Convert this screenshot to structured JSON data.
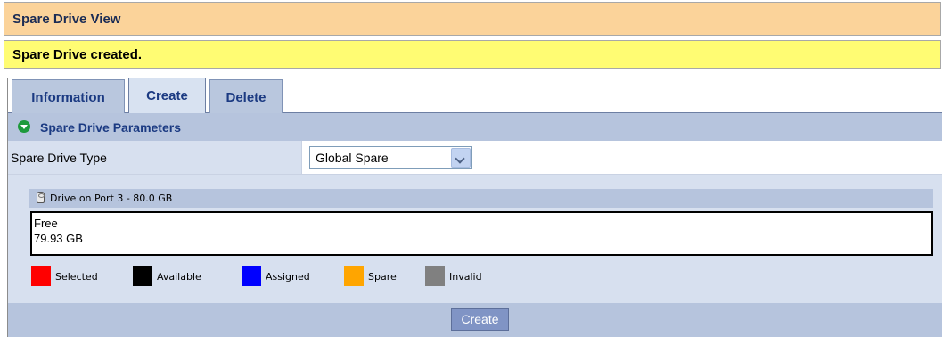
{
  "page": {
    "title": "Spare Drive View",
    "status_message": "Spare Drive created."
  },
  "tabs": [
    {
      "label": "Information",
      "active": false
    },
    {
      "label": "Create",
      "active": true
    },
    {
      "label": "Delete",
      "active": false
    }
  ],
  "section": {
    "title": "Spare Drive Parameters",
    "icon": "collapse-arrow-icon"
  },
  "params": {
    "spare_drive_type_label": "Spare Drive Type",
    "spare_drive_type_value": "Global Spare"
  },
  "drive": {
    "header": "Drive on Port 3 - 80.0 GB",
    "icon": "hard-drive-icon",
    "segment_status": "Free",
    "segment_size": "79.93 GB"
  },
  "legend": [
    {
      "label": "Selected",
      "color": "#ff0000"
    },
    {
      "label": "Available",
      "color": "#000000"
    },
    {
      "label": "Assigned",
      "color": "#0000ff"
    },
    {
      "label": "Spare",
      "color": "#ffa500"
    },
    {
      "label": "Invalid",
      "color": "#808080"
    }
  ],
  "actions": {
    "create_label": "Create"
  },
  "colors": {
    "title_bar": "#fbd39a",
    "message_bar": "#fffc73",
    "accent": "#1b3a82"
  }
}
